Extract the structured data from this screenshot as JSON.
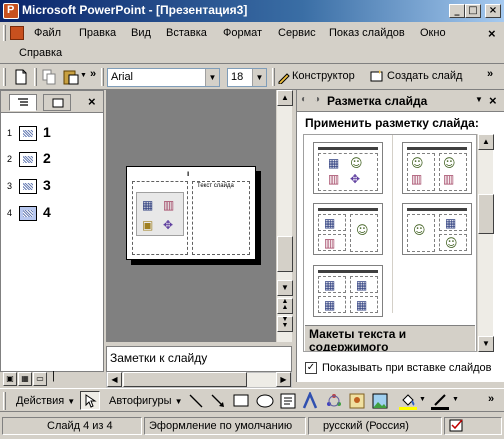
{
  "window": {
    "title": "Microsoft PowerPoint - [Презентация3]",
    "buttons": [
      "_",
      "□",
      "×"
    ]
  },
  "menu": {
    "items": [
      "Файл",
      "Правка",
      "Вид",
      "Вставка",
      "Формат",
      "Сервис",
      "Показ слайдов",
      "Окно"
    ],
    "help": "Справка",
    "close_doc": "×"
  },
  "toolbar": {
    "font": "Arial",
    "size": "18",
    "designer": "Конструктор",
    "new_slide": "Создать слайд",
    "more": "»"
  },
  "outline": {
    "slides": [
      {
        "num": "1",
        "label": "1"
      },
      {
        "num": "2",
        "label": "2"
      },
      {
        "num": "3",
        "label": "3"
      },
      {
        "num": "4",
        "label": "4"
      }
    ],
    "close": "×"
  },
  "slide": {
    "title_marker": "ı",
    "text_placeholder": "Текст слайда"
  },
  "notes": {
    "placeholder": "Заметки к слайду"
  },
  "taskpane": {
    "title": "Разметка слайда",
    "apply_label": "Применить разметку слайда:",
    "section": "Макеты текста и содержимого",
    "checkbox_label": "Показывать при вставке слайдов",
    "checkbox_checked": true
  },
  "drawbar": {
    "actions": "Действия",
    "autoshapes": "Автофигуры"
  },
  "status": {
    "slide": "Слайд 4 из 4",
    "design": "Эформление по умолчанию",
    "language": "русский (Россия)"
  }
}
